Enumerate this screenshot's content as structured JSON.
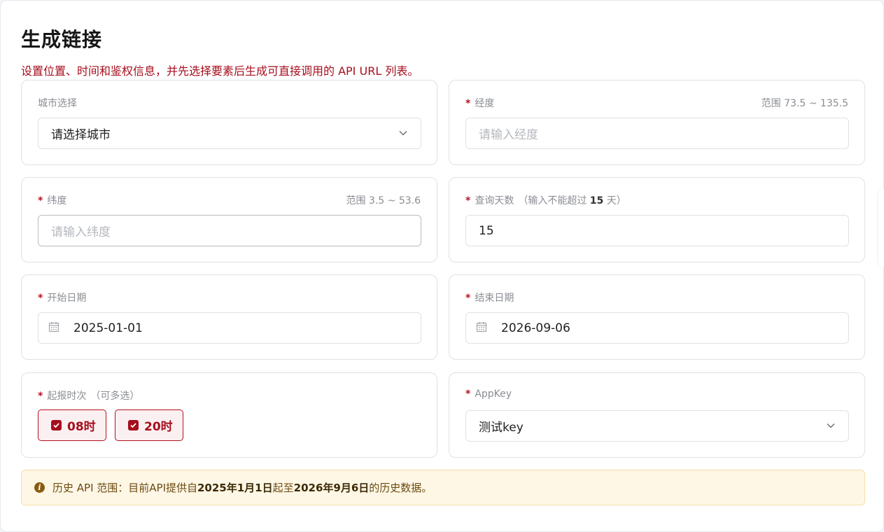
{
  "header": {
    "title": "生成链接",
    "subtitle": "设置位置、时间和鉴权信息，并先选择要素后生成可直接调用的 API URL 列表。"
  },
  "city": {
    "label": "城市选择",
    "value": "请选择城市"
  },
  "longitude": {
    "label": "经度",
    "range": "范围 73.5 ~ 135.5",
    "placeholder": "请输入经度"
  },
  "latitude": {
    "label": "纬度",
    "range": "范围 3.5 ~ 53.6",
    "placeholder": "请输入纬度"
  },
  "days": {
    "label": "查询天数",
    "hint_prefix": "（输入不能超过 ",
    "hint_num": "15",
    "hint_suffix": " 天）",
    "value": "15"
  },
  "start_date": {
    "label": "开始日期",
    "value": "2025-01-01"
  },
  "end_date": {
    "label": "结束日期",
    "value": "2026-09-06"
  },
  "report_time": {
    "label": "起报时次",
    "hint": "（可多选）",
    "options": [
      "08时",
      "20时"
    ]
  },
  "appkey": {
    "label": "AppKey",
    "value": "测试key"
  },
  "notice": {
    "prefix": "历史 API 范围：目前API提供自",
    "start": "2025年1月1日",
    "middle": "起至",
    "end": "2026年9月6日",
    "suffix": "的历史数据。"
  },
  "colors": {
    "accent": "#a50e1d",
    "notice_bg": "#fff7e6"
  },
  "icons": {
    "select": "chevron-down-icon",
    "date": "calendar-icon",
    "check": "checkbox-checked-icon",
    "info": "info-icon"
  }
}
